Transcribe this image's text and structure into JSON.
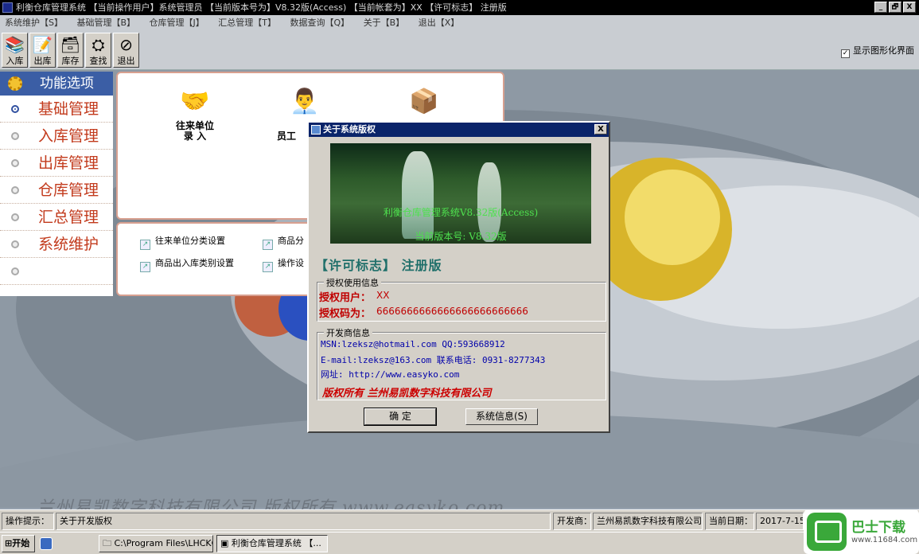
{
  "window": {
    "title": "利衡仓库管理系统  【当前操作用户】系统管理员  【当前版本号为】V8.32版(Access)  【当前帐套为】XX  【许可标志】 注册版",
    "controls": [
      "_",
      "🗗",
      "X"
    ]
  },
  "menu": {
    "items": [
      "系统维护【S】",
      "基础管理【B】",
      "仓库管理【J】",
      "汇总管理【T】",
      "数据查询【Q】",
      "关于【B】",
      "退出【X】"
    ]
  },
  "toolbar": {
    "buttons": [
      {
        "label": "入库",
        "icon": "books-in-icon"
      },
      {
        "label": "出库",
        "icon": "books-out-icon"
      },
      {
        "label": "库存",
        "icon": "inventory-icon"
      },
      {
        "label": "查找",
        "icon": "binoculars-icon"
      },
      {
        "label": "退出",
        "icon": "exit-icon"
      }
    ],
    "graphic_checkbox": {
      "label": "显示图形化界面",
      "checked": true
    }
  },
  "sidebar": {
    "header": "功能选项",
    "items": [
      {
        "label": "基础管理",
        "active": true
      },
      {
        "label": "入库管理",
        "active": false
      },
      {
        "label": "出库管理",
        "active": false
      },
      {
        "label": "仓库管理",
        "active": false
      },
      {
        "label": "汇总管理",
        "active": false
      },
      {
        "label": "系统维护",
        "active": false
      },
      {
        "label": "",
        "active": false
      }
    ]
  },
  "panel": {
    "big_icons": [
      {
        "line1": "往来单位",
        "line2": "录  入"
      },
      {
        "line1": "员工",
        "line2": ""
      },
      {
        "line1": "",
        "line2": ""
      }
    ],
    "sub_items": [
      "往来单位分类设置",
      "商品分",
      "商品出入库类别设置",
      "操作设"
    ]
  },
  "about": {
    "title": "关于系统版权",
    "close": "X",
    "banner_line1": "利衡仓库管理系统V8.32版(Access)",
    "banner_line2": "当前版本号: V8.32版",
    "license": "【许可标志】  注册版",
    "auth_group": "授权使用信息",
    "auth_user_label": "授权用户：",
    "auth_user_value": "XX",
    "auth_code_label": "授权码为：",
    "auth_code_value": "6666666666666666666666666",
    "dev_group": "开发商信息",
    "msn": "MSN:lzeksz@hotmail.com  QQ:593668912",
    "email": "E-mail:lzeksz@163.com   联系电话: 0931-8277343",
    "website": "网址: http://www.easyko.com",
    "copyright": "版权所有   兰州易凯数字科技有限公司",
    "ok_button": "确    定",
    "sysinfo_button": "系统信息(S)"
  },
  "background_text": "兰州易凯数字科技有限公司    版权所有    www.easyko.com",
  "status": {
    "hint_label": "操作提示：",
    "hint_value": "关于开发版权",
    "dev_label": "开发商：",
    "dev_value": "兰州易凯数字科技有限公司",
    "date_label": "当前日期：",
    "date_value": "2017-7-15"
  },
  "taskbar": {
    "start": "开始",
    "tasks": [
      "C:\\Program Files\\LHCKGL...",
      "利衡仓库管理系统  【..."
    ]
  },
  "watermark": {
    "name": "巴士下载",
    "url": "www.11684.com"
  },
  "colors": {
    "accent": "#3b5ea5",
    "menu_red": "#c23a1c",
    "dialog_title": "#0a246a"
  }
}
